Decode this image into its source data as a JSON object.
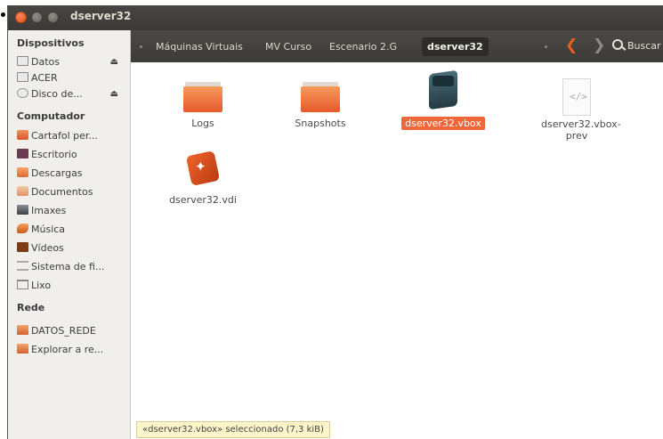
{
  "window": {
    "title": "dserver32"
  },
  "sidebar": {
    "sections": [
      {
        "heading": "Dispositivos",
        "items": [
          {
            "label": "Datos",
            "icon": "drive-icon",
            "eject": true
          },
          {
            "label": "ACER",
            "icon": "drive-icon",
            "eject": false
          },
          {
            "label": "Disco de...",
            "icon": "disc-icon",
            "eject": true
          }
        ]
      },
      {
        "heading": "Computador",
        "items": [
          {
            "label": "Cartafol per...",
            "icon": "home-folder-icon"
          },
          {
            "label": "Escritorio",
            "icon": "desktop-icon"
          },
          {
            "label": "Descargas",
            "icon": "downloads-icon"
          },
          {
            "label": "Documentos",
            "icon": "documents-icon"
          },
          {
            "label": "Imaxes",
            "icon": "pictures-icon"
          },
          {
            "label": "Música",
            "icon": "music-icon"
          },
          {
            "label": "Vídeos",
            "icon": "videos-icon"
          },
          {
            "label": "Sistema de fi...",
            "icon": "filesystem-icon"
          },
          {
            "label": "Lixo",
            "icon": "trash-icon"
          }
        ]
      },
      {
        "heading": "Rede",
        "items": [
          {
            "label": "DATOS_REDE",
            "icon": "network-icon"
          },
          {
            "label": "Explorar a re...",
            "icon": "network-icon"
          }
        ]
      }
    ],
    "eject_glyph": "⏏"
  },
  "toolbar": {
    "breadcrumbs": [
      "Máquinas Virtuais",
      "MV Curso",
      "Escenario 2.G",
      "dserver32"
    ],
    "back_glyph": "❮",
    "forward_glyph": "❯",
    "search_label": "Buscar"
  },
  "files": [
    {
      "name": "Logs",
      "type": "folder"
    },
    {
      "name": "Snapshots",
      "type": "folder"
    },
    {
      "name": "dserver32.vbox",
      "type": "vbox",
      "selected": true
    },
    {
      "name": "dserver32.vbox-prev",
      "type": "document",
      "glyph": "</>"
    },
    {
      "name": "dserver32.vdi",
      "type": "vdi",
      "glyph": "✦"
    }
  ],
  "status_text": "«dserver32.vbox» seleccionado (7,3 kiB)",
  "colors": {
    "accent": "#f0673a",
    "titlebar": "#3c3b37",
    "status_bg": "#fbf5c9"
  }
}
